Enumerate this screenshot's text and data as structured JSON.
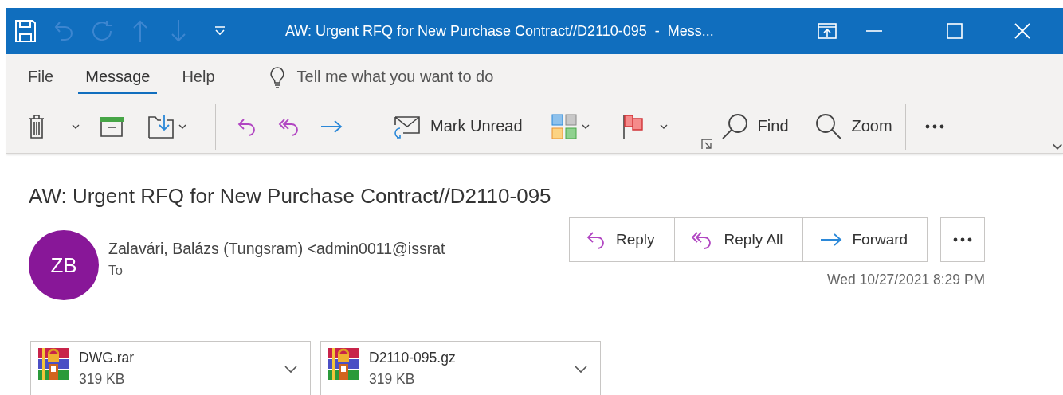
{
  "title_bar": {
    "title": "AW: Urgent RFQ for New Purchase Contract//D2110-095  -  Mess...",
    "quick_access": [
      {
        "disabled": false
      },
      {
        "disabled": true
      },
      {
        "disabled": true
      },
      {
        "disabled": true
      },
      {
        "disabled": true
      }
    ]
  },
  "tabs": [
    {
      "label": "File",
      "selected": false
    },
    {
      "label": "Message",
      "selected": true
    },
    {
      "label": "Help",
      "selected": false
    }
  ],
  "tell_me": {
    "placeholder": "Tell me what you want to do"
  },
  "toolbar": {
    "mark_unread": "Mark Unread",
    "find": "Find",
    "zoom": "Zoom"
  },
  "message": {
    "subject": "AW: Urgent RFQ for New Purchase Contract//D2110-095",
    "initials": "ZB",
    "sender": "Zalavári, Balázs (Tungsram) <admin0011@issrat",
    "to_label": "To",
    "actions": [
      "Reply",
      "Reply All",
      "Forward"
    ],
    "date": "Wed 10/27/2021 8:29 PM"
  },
  "attachments": [
    {
      "name": "DWG.rar",
      "size": "319 KB"
    },
    {
      "name": "D2110-095.gz",
      "size": "319 KB"
    }
  ]
}
